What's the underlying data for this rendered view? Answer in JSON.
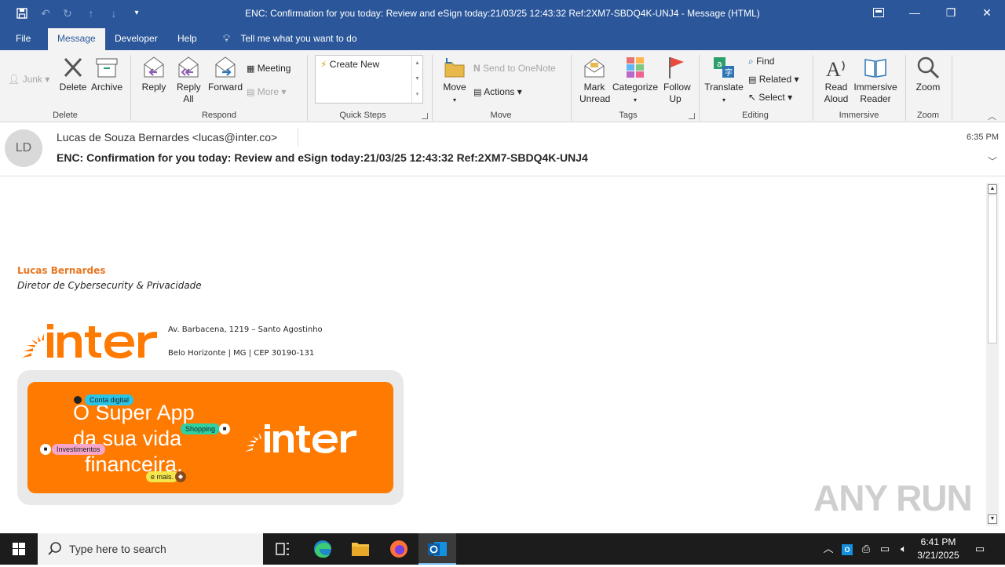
{
  "window": {
    "title": "ENC: Confirmation for you today: Review and eSign today:21/03/25 12:43:32 Ref:2XM7-SBDQ4K-UNJ4  -  Message (HTML)"
  },
  "quick_access": {
    "icons": [
      "save-icon",
      "undo-icon",
      "redo-icon",
      "up-icon",
      "down-icon",
      "customize-icon"
    ]
  },
  "tabs": [
    {
      "label": "File"
    },
    {
      "label": "Message"
    },
    {
      "label": "Developer"
    },
    {
      "label": "Help"
    }
  ],
  "tell_me": "Tell me what you want to do",
  "ribbon": {
    "junk": "Junk",
    "delete": "Delete",
    "archive": "Archive",
    "delete_group": "Delete",
    "reply": "Reply",
    "reply_all": "Reply All",
    "forward": "Forward",
    "meeting": "Meeting",
    "more": "More",
    "respond_group": "Respond",
    "create_new": "Create New",
    "quick_steps_group": "Quick Steps",
    "move": "Move",
    "send_onenote": "Send to OneNote",
    "actions": "Actions",
    "move_group": "Move",
    "mark_unread": "Mark Unread",
    "categorize": "Categorize",
    "follow_up": "Follow Up",
    "tags_group": "Tags",
    "translate": "Translate",
    "find": "Find",
    "related": "Related",
    "select": "Select",
    "editing_group": "Editing",
    "read_aloud": "Read Aloud",
    "immersive_reader": "Immersive Reader",
    "immersive_group": "Immersive",
    "zoom": "Zoom",
    "zoom_group": "Zoom"
  },
  "message": {
    "avatar_initials": "LD",
    "sender": "Lucas de Souza Bernardes <lucas@inter.co>",
    "time": "6:35 PM",
    "subject": "ENC: Confirmation for you today: Review and eSign today:21/03/25 12:43:32 Ref:2XM7-SBDQ4K-UNJ4"
  },
  "signature": {
    "name": "Lucas Bernardes",
    "role": "Diretor de Cybersecurity & Privacidade",
    "logo_text": "inter",
    "address_line1": "Av. Barbacena, 1219 – Santo Agostinho",
    "address_line2": "Belo Horizonte | MG | CEP 30190-131"
  },
  "banner": {
    "line1": "O Super App",
    "line2": "da sua vida",
    "line3": "financeira.",
    "tag_conta": "Conta digital",
    "tag_shopping": "Shopping",
    "tag_invest": "Investimentos",
    "tag_mais": "e mais.",
    "logo_text": "inter"
  },
  "watermark": "ANY RUN",
  "taskbar": {
    "search_placeholder": "Type here to search",
    "clock_time": "6:41 PM",
    "clock_date": "3/21/2025"
  },
  "colors": {
    "titlebar": "#2b579a",
    "inter_orange": "#ff7a00",
    "signature_name": "#e87722"
  }
}
